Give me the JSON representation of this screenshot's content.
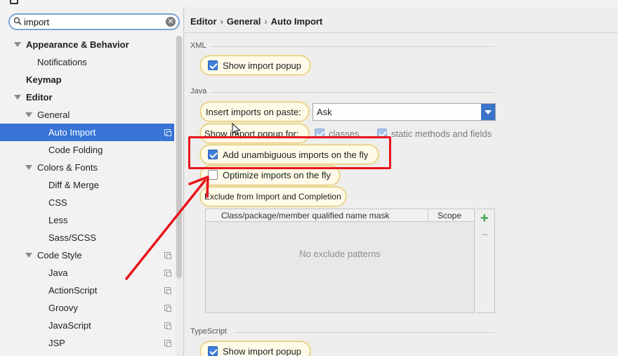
{
  "search": {
    "value": "import",
    "clear_icon": "clear-icon",
    "search_icon": "search-icon"
  },
  "sidebar": {
    "items": [
      {
        "label": "Appearance & Behavior",
        "bold": true,
        "expanded": true,
        "level": 0
      },
      {
        "label": "Notifications",
        "level": 1
      },
      {
        "label": "Keymap",
        "bold": true,
        "level": 0
      },
      {
        "label": "Editor",
        "bold": true,
        "expanded": true,
        "level": 0
      },
      {
        "label": "General",
        "expanded": true,
        "level": 1
      },
      {
        "label": "Auto Import",
        "level": 2,
        "selected": true,
        "copy": true
      },
      {
        "label": "Code Folding",
        "level": 2
      },
      {
        "label": "Colors & Fonts",
        "expanded": true,
        "level": 1
      },
      {
        "label": "Diff & Merge",
        "level": 2
      },
      {
        "label": "CSS",
        "level": 2
      },
      {
        "label": "Less",
        "level": 2
      },
      {
        "label": "Sass/SCSS",
        "level": 2
      },
      {
        "label": "Code Style",
        "expanded": true,
        "level": 1,
        "copy": true
      },
      {
        "label": "Java",
        "level": 2,
        "copy": true
      },
      {
        "label": "ActionScript",
        "level": 2,
        "copy": true
      },
      {
        "label": "Groovy",
        "level": 2,
        "copy": true
      },
      {
        "label": "JavaScript",
        "level": 2,
        "copy": true
      },
      {
        "label": "JSP",
        "level": 2,
        "copy": true
      }
    ]
  },
  "breadcrumb": {
    "part1": "Editor",
    "part2": "General",
    "part3": "Auto Import",
    "separator": "›"
  },
  "xml": {
    "title": "XML",
    "show_import_popup": "Show import popup"
  },
  "java": {
    "title": "Java",
    "insert_imports_label": "Insert imports on paste:",
    "insert_imports_value": "Ask",
    "show_popup_for_label": "Show import popup for:",
    "classes": "classes",
    "static_methods": "static methods and fields",
    "add_unambiguous": "Add unambiguous imports on the fly",
    "optimize_imports": "Optimize imports on the fly",
    "exclude_title": "Exclude from Import and Completion",
    "table": {
      "col1": "Class/package/member qualified name mask",
      "col2": "Scope",
      "empty": "No exclude patterns"
    }
  },
  "typescript": {
    "title": "TypeScript",
    "show_import_popup": "Show import popup"
  },
  "colors": {
    "accent": "#3875d7",
    "highlight_border": "#e8141c"
  }
}
